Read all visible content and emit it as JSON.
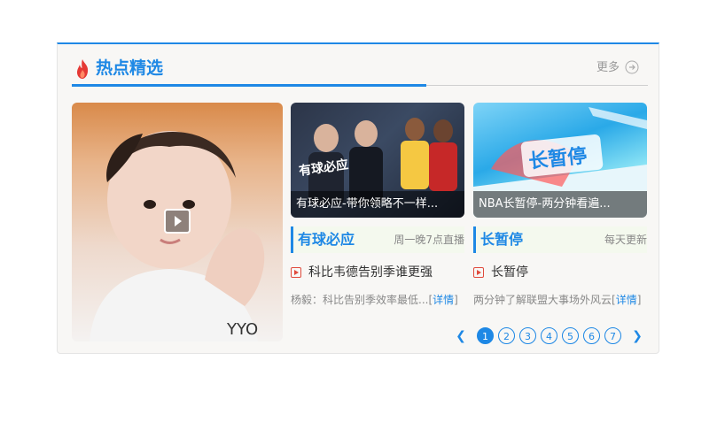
{
  "header": {
    "title": "热点精选",
    "more": "更多"
  },
  "featured": {
    "image": "young-man-portrait",
    "play_icon": "play-icon"
  },
  "cards": [
    {
      "caption": "有球必应-带你领略不一样...",
      "section": "有球必应",
      "schedule": "周一晚7点直播",
      "link": "科比韦德告别季谁更强",
      "desc": "杨毅：科比告别季效率最低...",
      "detail": "详情"
    },
    {
      "caption": "NBA长暂停-两分钟看遍...",
      "section": "长暂停",
      "schedule": "每天更新",
      "link": "长暂停",
      "desc": "两分钟了解联盟大事场外风云",
      "detail": "详情"
    }
  ],
  "pager": {
    "pages": [
      "1",
      "2",
      "3",
      "4",
      "5",
      "6",
      "7"
    ],
    "active": "1"
  },
  "colors": {
    "accent": "#1e88e5",
    "fire": "#e53935"
  }
}
